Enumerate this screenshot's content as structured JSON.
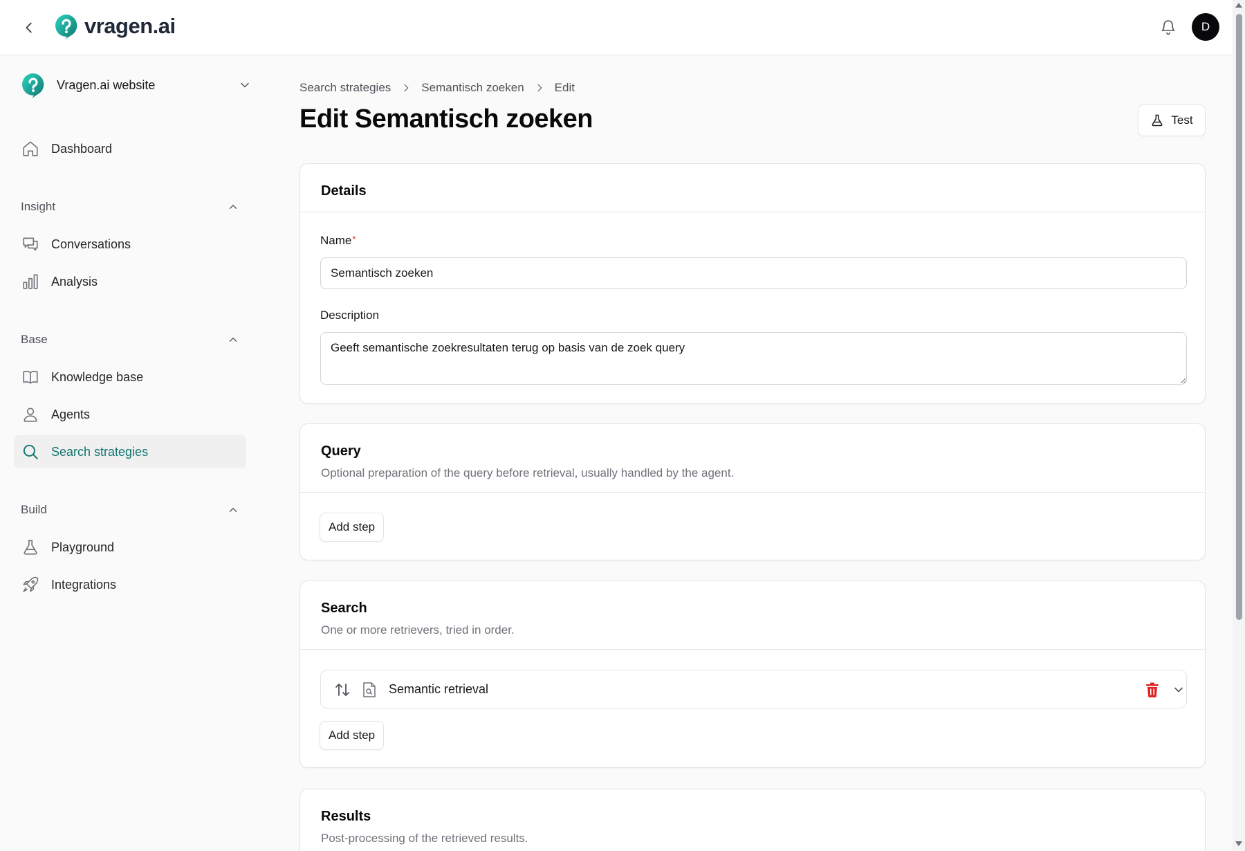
{
  "app": {
    "brand": "vragen.ai",
    "user_initial": "D"
  },
  "sidebar": {
    "workspace": "Vragen.ai website",
    "dashboard": "Dashboard",
    "sections": [
      {
        "title": "Insight",
        "items": [
          "Conversations",
          "Analysis"
        ]
      },
      {
        "title": "Base",
        "items": [
          "Knowledge base",
          "Agents",
          "Search strategies"
        ]
      },
      {
        "title": "Build",
        "items": [
          "Playground",
          "Integrations"
        ]
      }
    ],
    "active_item": "Search strategies"
  },
  "breadcrumb": [
    "Search strategies",
    "Semantisch zoeken",
    "Edit"
  ],
  "page_title": "Edit Semantisch zoeken",
  "test_button": "Test",
  "details": {
    "title": "Details",
    "name_label": "Name",
    "required_mark": "*",
    "name_value": "Semantisch zoeken",
    "description_label": "Description",
    "description_value": "Geeft semantische zoekresultaten terug op basis van de zoek query"
  },
  "query": {
    "title": "Query",
    "subtitle": "Optional preparation of the query before retrieval, usually handled by the agent.",
    "add_step": "Add step"
  },
  "search": {
    "title": "Search",
    "subtitle": "One or more retrievers, tried in order.",
    "steps": [
      "Semantic retrieval"
    ],
    "add_step": "Add step"
  },
  "results": {
    "title": "Results",
    "subtitle": "Post-processing of the retrieved results."
  },
  "colors": {
    "brand_teal": "#0f766e",
    "danger": "#dc2626"
  }
}
